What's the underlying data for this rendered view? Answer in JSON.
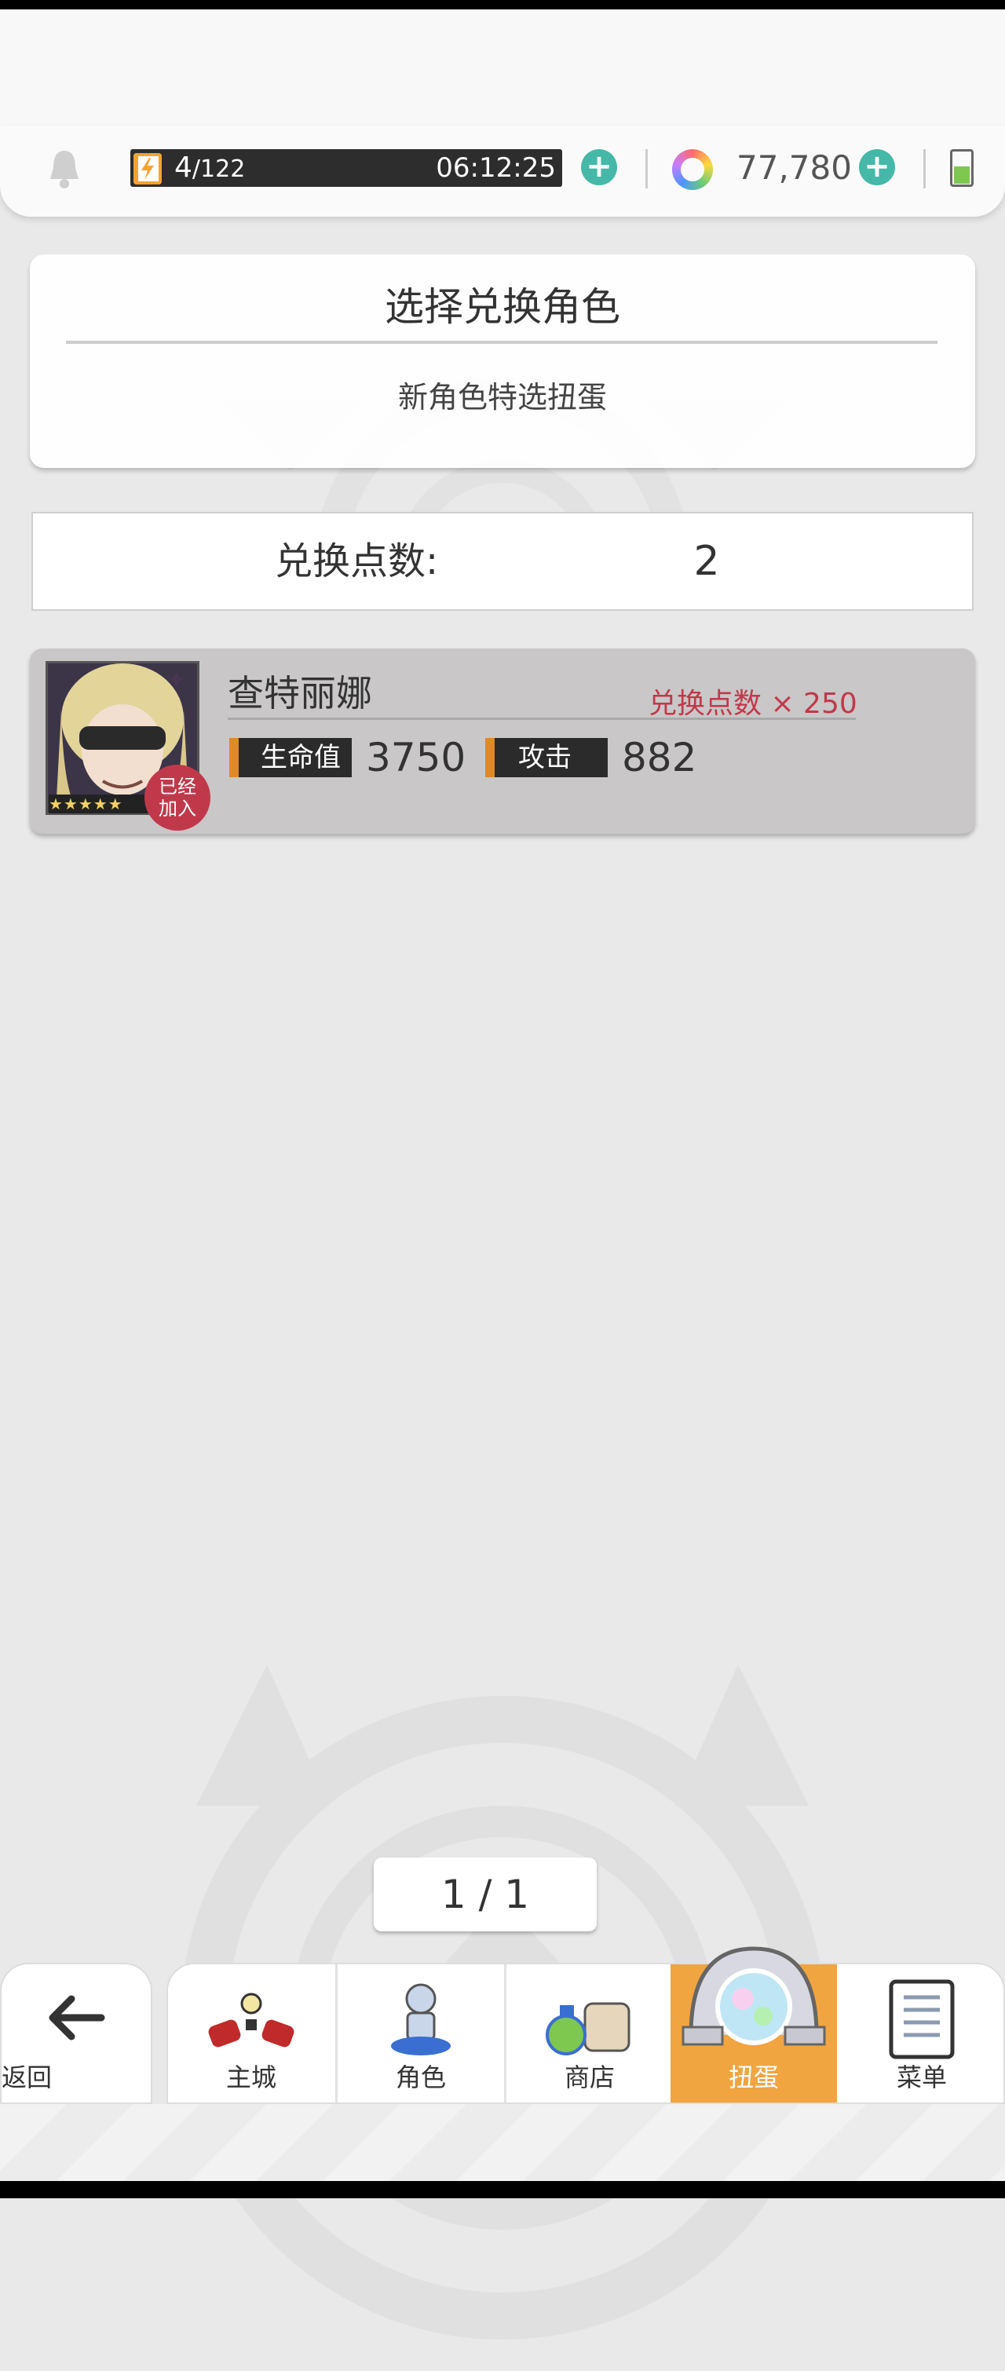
{
  "resources": {
    "stamina_current": "4",
    "stamina_max": "/122",
    "stamina_timer": "06:12:25",
    "gems": "77,780"
  },
  "select_card": {
    "title": "选择兑换角色",
    "subtitle": "新角色特选扭蛋"
  },
  "points": {
    "label": "兑换点数:",
    "value": "2"
  },
  "character": {
    "name": "查特丽娜",
    "cost": "兑换点数 × 250",
    "joined_line1": "已经",
    "joined_line2": "加入",
    "stars": "★★★★★",
    "hp_label": "生命值",
    "hp_value": "3750",
    "atk_label": "攻击",
    "atk_value": "882"
  },
  "pager": {
    "text": "1 / 1"
  },
  "nav": {
    "back": "返回",
    "main_city": "主城",
    "characters": "角色",
    "shop": "商店",
    "gacha": "扭蛋",
    "menu": "菜单"
  },
  "colors": {
    "accent_teal": "#45b8a8",
    "active_tab": "#f0a540",
    "cost_red": "#c0394a",
    "stat_orange": "#e0892a"
  }
}
